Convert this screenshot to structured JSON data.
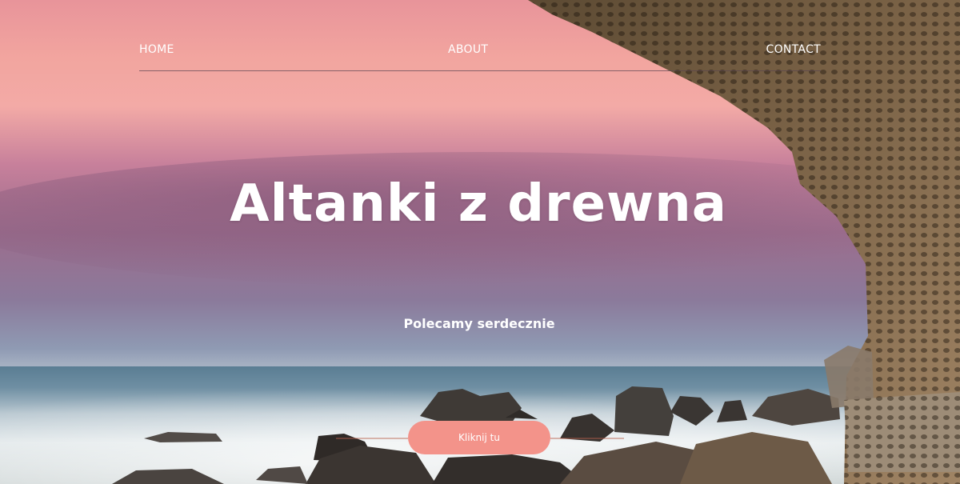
{
  "nav": {
    "items": [
      {
        "label": "HOME"
      },
      {
        "label": "ABOUT"
      },
      {
        "label": "CONTACT"
      }
    ]
  },
  "hero": {
    "title": "Altanki z drewna",
    "subtitle": "Polecamy serdecznie",
    "cta_label": "Kliknij tu"
  },
  "colors": {
    "cta_background": "#f3938a",
    "text": "#ffffff"
  }
}
